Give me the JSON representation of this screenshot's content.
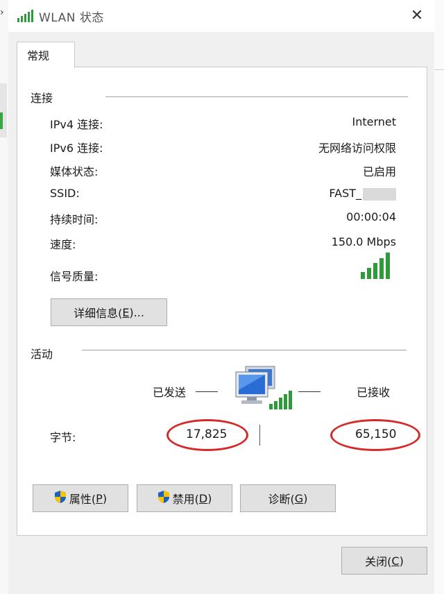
{
  "window": {
    "title": "WLAN 状态",
    "close_glyph": "✕"
  },
  "tab": {
    "label": "常规"
  },
  "connection": {
    "title": "连接",
    "rows": [
      {
        "label": "IPv4 连接:",
        "value": "Internet"
      },
      {
        "label": "IPv6 连接:",
        "value": "无网络访问权限"
      },
      {
        "label": "媒体状态:",
        "value": "已启用"
      },
      {
        "label": "SSID:",
        "value": "FAST_"
      },
      {
        "label": "持续时间:",
        "value": "00:00:04"
      },
      {
        "label": "速度:",
        "value": "150.0 Mbps"
      },
      {
        "label": "信号质量:",
        "value": ""
      }
    ],
    "signal_bars": 5,
    "details_button": {
      "label": "详细信息(",
      "key": "E",
      "tail": ")..."
    }
  },
  "activity": {
    "title": "活动",
    "sent_label": "已发送",
    "received_label": "已接收",
    "bytes_label": "字节:",
    "bytes_sent": "17,825",
    "bytes_received": "65,150",
    "dash": "—"
  },
  "buttons": {
    "properties": {
      "label": "属性(",
      "key": "P",
      "tail": ")"
    },
    "disable": {
      "label": "禁用(",
      "key": "D",
      "tail": ")"
    },
    "diagnose": {
      "label": "诊断(",
      "key": "G",
      "tail": ")"
    },
    "close": {
      "label": "关闭(",
      "key": "C",
      "tail": ")"
    }
  },
  "colors": {
    "signal": "#2e9a3a",
    "highlight": "#d42a2a",
    "shield_blue": "#1f5fbf",
    "shield_yellow": "#f5c400"
  }
}
